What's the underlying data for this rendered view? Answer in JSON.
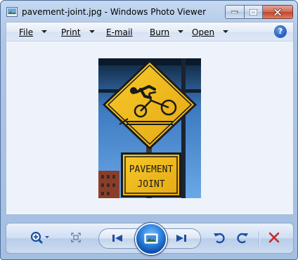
{
  "window": {
    "title": "pavement-joint.jpg - Windows Photo Viewer"
  },
  "menu": {
    "items": [
      {
        "label": "File",
        "has_dropdown": true
      },
      {
        "label": "Print",
        "has_dropdown": true
      },
      {
        "label": "E-mail",
        "has_dropdown": false
      },
      {
        "label": "Burn",
        "has_dropdown": true
      },
      {
        "label": "Open",
        "has_dropdown": true
      }
    ],
    "help_glyph": "?"
  },
  "photo": {
    "sign_top": "",
    "sign_line1": "PAVEMENT",
    "sign_line2": "JOINT"
  },
  "controls": {
    "icons": [
      "zoom-icon",
      "actual-size-icon",
      "previous-icon",
      "slideshow-icon",
      "next-icon",
      "rotate-counterclockwise-icon",
      "rotate-clockwise-icon",
      "delete-icon"
    ]
  },
  "colors": {
    "sign_yellow": "#f2c21a",
    "sky_blue": "#5f9fe0",
    "delete_red": "#c8282c",
    "accent_blue": "#1f5cc2"
  }
}
